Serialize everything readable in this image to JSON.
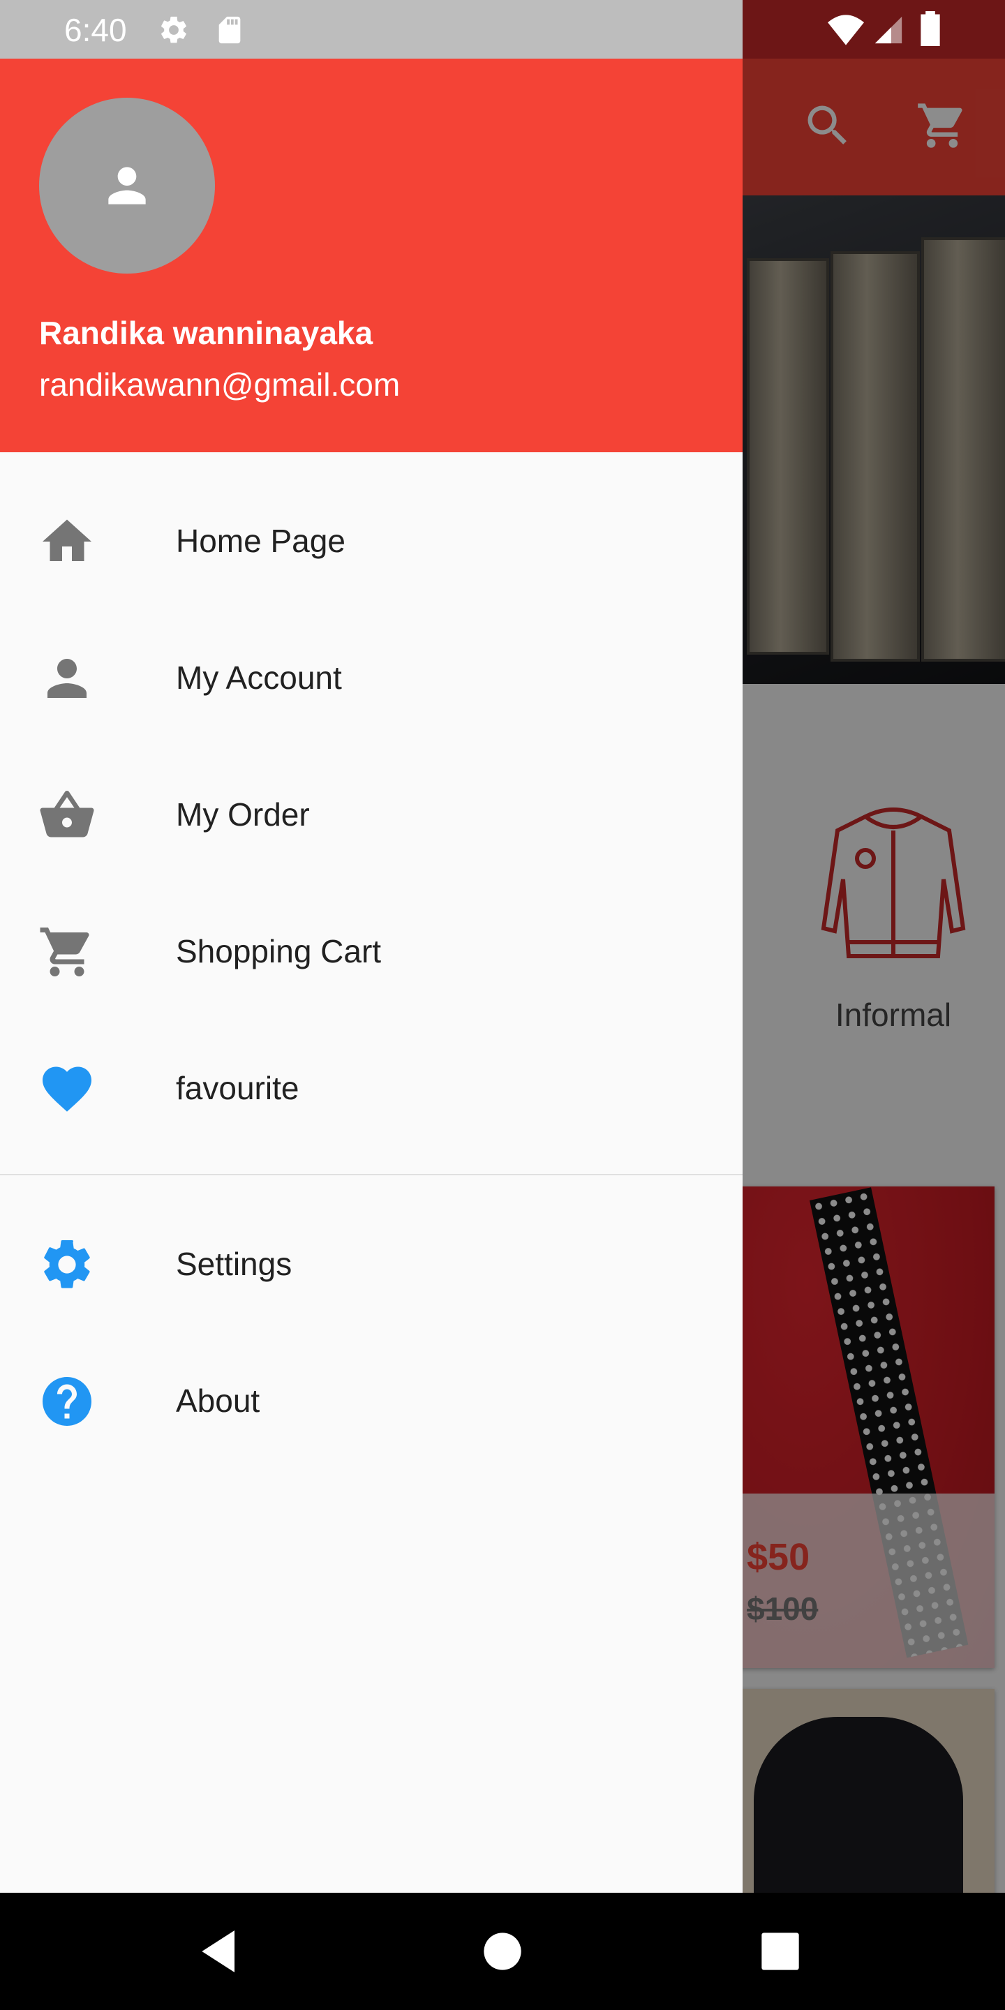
{
  "status_bar": {
    "time": "6:40"
  },
  "background": {
    "category_label": "Informal",
    "product": {
      "price": "$50",
      "old_price": "$100"
    }
  },
  "drawer": {
    "user_name": "Randika wanninayaka",
    "user_email": "randikawann@gmail.com",
    "menu": [
      {
        "label": "Home Page",
        "icon": "home-icon"
      },
      {
        "label": "My Account",
        "icon": "person-icon"
      },
      {
        "label": "My Order",
        "icon": "basket-icon"
      },
      {
        "label": "Shopping Cart",
        "icon": "cart-icon"
      },
      {
        "label": "favourite",
        "icon": "heart-icon"
      }
    ],
    "secondary_menu": [
      {
        "label": "Settings",
        "icon": "settings-icon"
      },
      {
        "label": "About",
        "icon": "help-icon"
      }
    ]
  },
  "colors": {
    "primary": "#f44336",
    "accent": "#2196f3",
    "icon_gray": "#757575"
  }
}
